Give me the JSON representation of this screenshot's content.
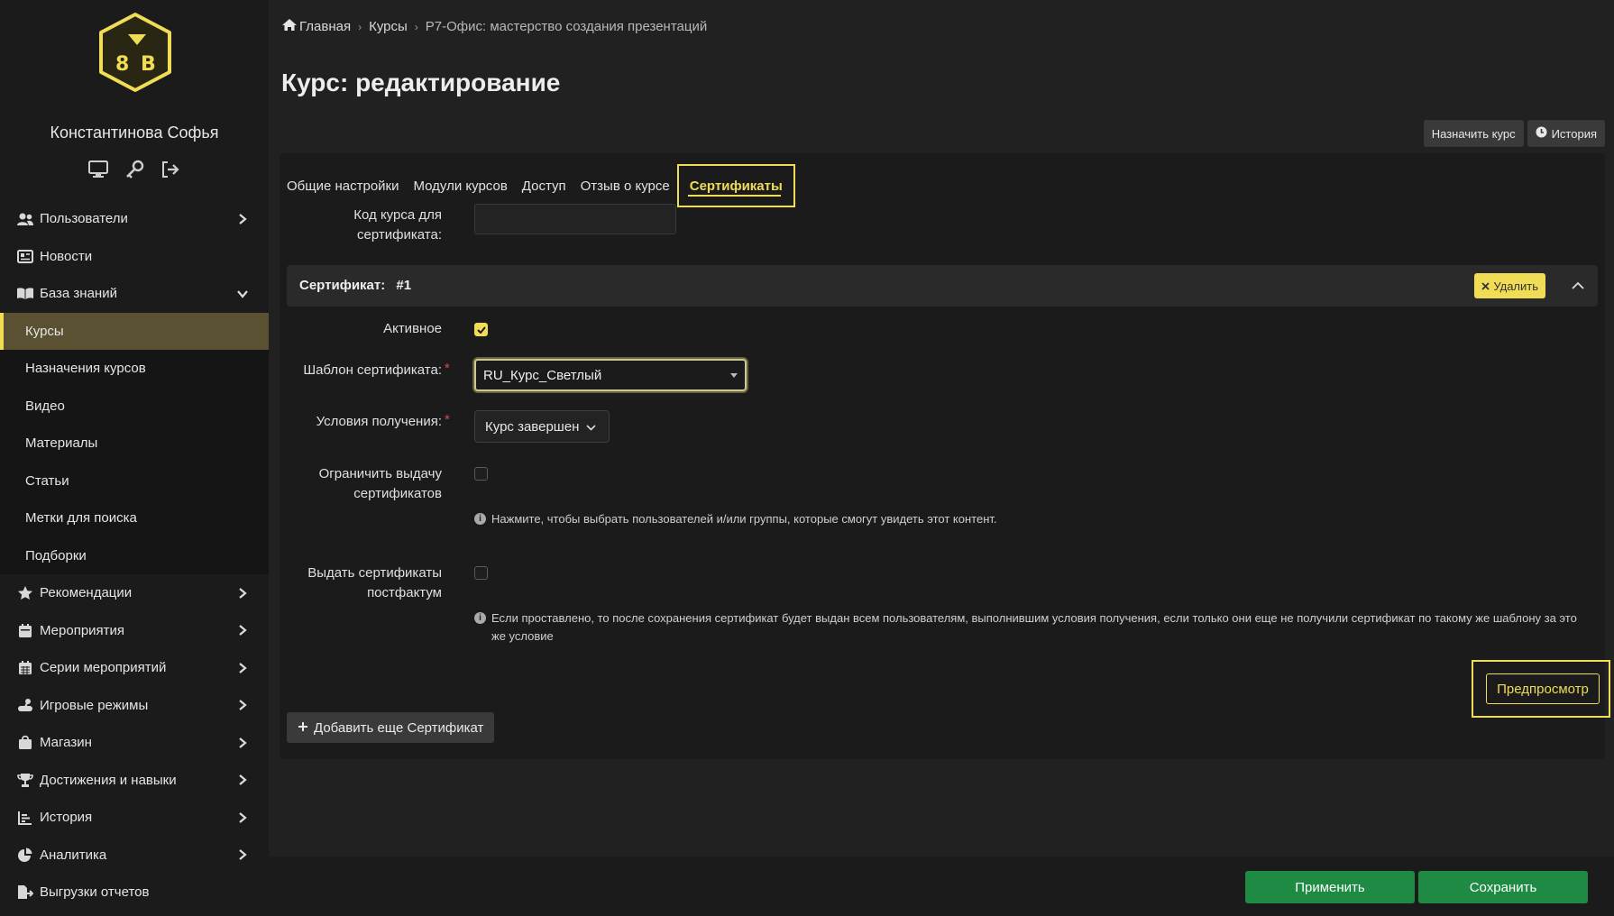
{
  "sidebar": {
    "user_name": "Константинова Софья",
    "user_icons": [
      "monitor-icon",
      "key-icon",
      "logout-icon"
    ],
    "items": [
      {
        "label": "Пользователи",
        "icon": "users-icon",
        "arrow": "chevron-right"
      },
      {
        "label": "Новости",
        "icon": "newspaper-icon"
      },
      {
        "label": "База знаний",
        "icon": "book-icon",
        "arrow": "chevron-down"
      }
    ],
    "sub_items": [
      {
        "label": "Курсы",
        "active": true
      },
      {
        "label": "Назначения курсов"
      },
      {
        "label": "Видео"
      },
      {
        "label": "Материалы"
      },
      {
        "label": "Статьи"
      },
      {
        "label": "Метки для поиска"
      },
      {
        "label": "Подборки"
      }
    ],
    "items_after": [
      {
        "label": "Рекомендации",
        "icon": "star-icon",
        "arrow": "chevron-right"
      },
      {
        "label": "Мероприятия",
        "icon": "calendar-icon",
        "arrow": "chevron-right"
      },
      {
        "label": "Серии мероприятий",
        "icon": "calendar-grid-icon",
        "arrow": "chevron-right"
      },
      {
        "label": "Игровые режимы",
        "icon": "gamepad-icon",
        "arrow": "chevron-right"
      },
      {
        "label": "Магазин",
        "icon": "shopping-bag-icon",
        "arrow": "chevron-right"
      },
      {
        "label": "Достижения и навыки",
        "icon": "trophy-icon",
        "arrow": "chevron-right"
      },
      {
        "label": "История",
        "icon": "history-chart-icon",
        "arrow": "chevron-right"
      },
      {
        "label": "Аналитика",
        "icon": "pie-chart-icon",
        "arrow": "chevron-right"
      },
      {
        "label": "Выгрузки отчетов",
        "icon": "file-export-icon"
      }
    ]
  },
  "breadcrumb": {
    "home": "Главная",
    "courses": "Курсы",
    "current": "Р7-Офис: мастерство создания презентаций"
  },
  "page_title": "Курс: редактирование",
  "top_actions": {
    "assign": "Назначить курс",
    "history": "История"
  },
  "tabs": [
    "Общие настройки",
    "Модули курсов",
    "Доступ",
    "Отзыв о курсе",
    "Сертификаты"
  ],
  "form": {
    "course_code_label": "Код курса для сертификата:",
    "course_code_value": "",
    "cert_title": "Сертификат:",
    "cert_number": "#1",
    "delete_label": "Удалить",
    "active_label": "Активное",
    "template_label": "Шаблон сертификата:",
    "template_value": "RU_Курс_Светлый",
    "conditions_label": "Условия получения:",
    "conditions_value": "Курс завершен",
    "limit_label": "Ограничить выдачу сертификатов",
    "limit_hint": "Нажмите, чтобы выбрать пользователей и/или группы, которые смогут увидеть этот контент.",
    "postfact_label": "Выдать сертификаты постфактум",
    "postfact_hint": "Если проставлено, то после сохранения сертификат будет выдан всем пользователям, выполнившим условия получения, если только они еще не получили сертификат по такому же шаблону за это же условие",
    "preview_label": "Предпросмотр",
    "add_label": "Добавить еще Сертификат"
  },
  "footer": {
    "apply": "Применить",
    "save": "Сохранить"
  },
  "colors": {
    "accent": "#f0dc55",
    "success": "#1e8a44",
    "bg": "#1f1f1f"
  }
}
